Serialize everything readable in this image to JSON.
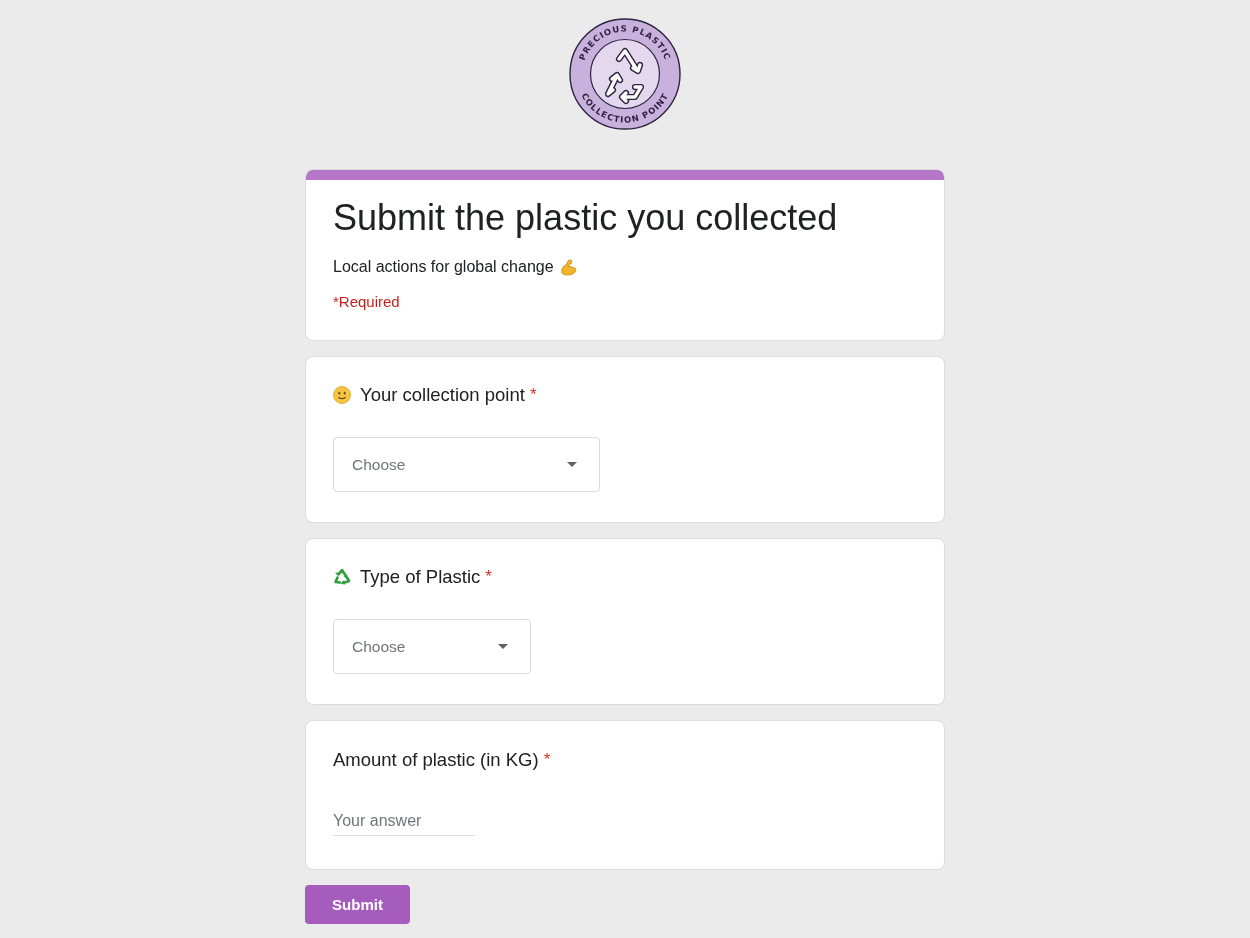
{
  "logo": {
    "top_text": "PRECIOUS PLASTIC",
    "bottom_text": "COLLECTION POINT"
  },
  "header": {
    "title": "Submit the plastic you collected",
    "description": "Local actions for global change",
    "required_note": "*Required"
  },
  "questions": [
    {
      "kind": "dropdown",
      "title": "Your collection point",
      "required_mark": "*",
      "placeholder": "Choose"
    },
    {
      "kind": "dropdown",
      "title": "Type of Plastic",
      "required_mark": "*",
      "placeholder": "Choose"
    },
    {
      "kind": "short_answer",
      "title": "Amount of plastic (in KG)",
      "required_mark": "*",
      "placeholder": "Your answer"
    }
  ],
  "submit": {
    "label": "Submit"
  }
}
